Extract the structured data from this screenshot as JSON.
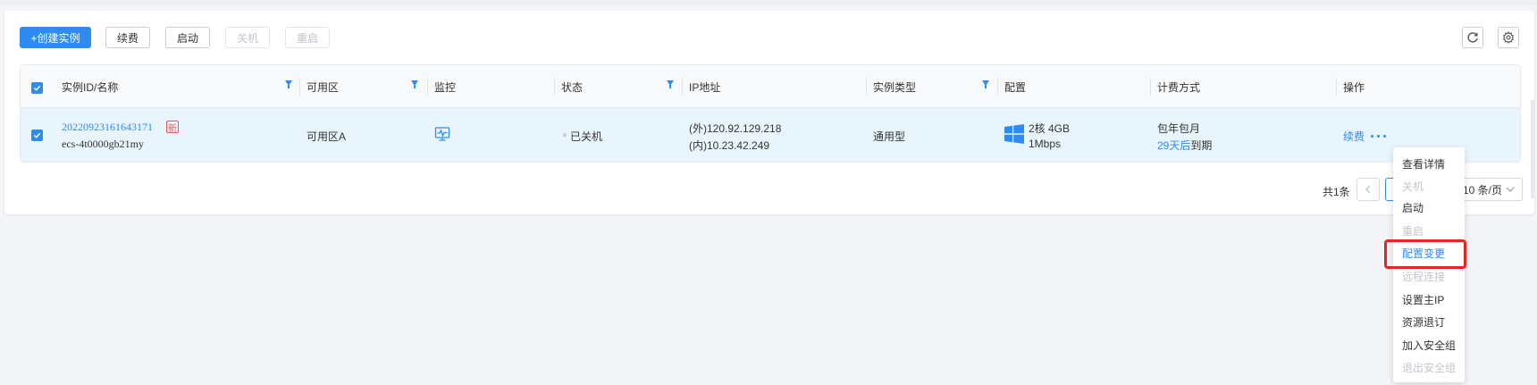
{
  "toolbar": {
    "create_label": "+创建实例",
    "renew_label": "续费",
    "start_label": "启动",
    "shutdown_label": "关机",
    "restart_label": "重启",
    "refresh_icon": "refresh-icon",
    "settings_icon": "gear-icon"
  },
  "table": {
    "columns": {
      "id_name": "实例ID/名称",
      "zone": "可用区",
      "monitor": "监控",
      "status": "状态",
      "ip": "IP地址",
      "instance_type": "实例类型",
      "config": "配置",
      "billing": "计费方式",
      "actions": "操作"
    },
    "row": {
      "instance_id": "20220923161643171",
      "new_badge": "新",
      "instance_name": "ecs-4t0000gb21my",
      "zone": "可用区A",
      "monitor_icon": "monitor-chart-icon",
      "status": "已关机",
      "ip_external": "(外)120.92.129.218",
      "ip_internal": "(内)10.23.42.249",
      "instance_type": "通用型",
      "os_icon": "windows-icon",
      "config_cpu_mem": "2核 4GB",
      "config_bandwidth": "1Mbps",
      "billing_mode": "包年包月",
      "expire_days": "29天后",
      "expire_suffix": "到期",
      "action_renew": "续费"
    }
  },
  "pagination": {
    "total": "共1条",
    "page_size": "10 条/页"
  },
  "more_menu": {
    "items": [
      {
        "label": "查看详情",
        "state": "enabled"
      },
      {
        "label": "关机",
        "state": "disabled"
      },
      {
        "label": "启动",
        "state": "enabled"
      },
      {
        "label": "重启",
        "state": "disabled"
      },
      {
        "label": "配置变更",
        "state": "active"
      },
      {
        "label": "远程连接",
        "state": "disabled"
      },
      {
        "label": "设置主IP",
        "state": "enabled"
      },
      {
        "label": "资源退订",
        "state": "enabled"
      },
      {
        "label": "加入安全组",
        "state": "enabled"
      },
      {
        "label": "退出安全组",
        "state": "disabled"
      }
    ]
  },
  "colors": {
    "primary": "#2e8cf0",
    "highlight": "#e8261f",
    "row_selected": "#e9f5fd"
  }
}
